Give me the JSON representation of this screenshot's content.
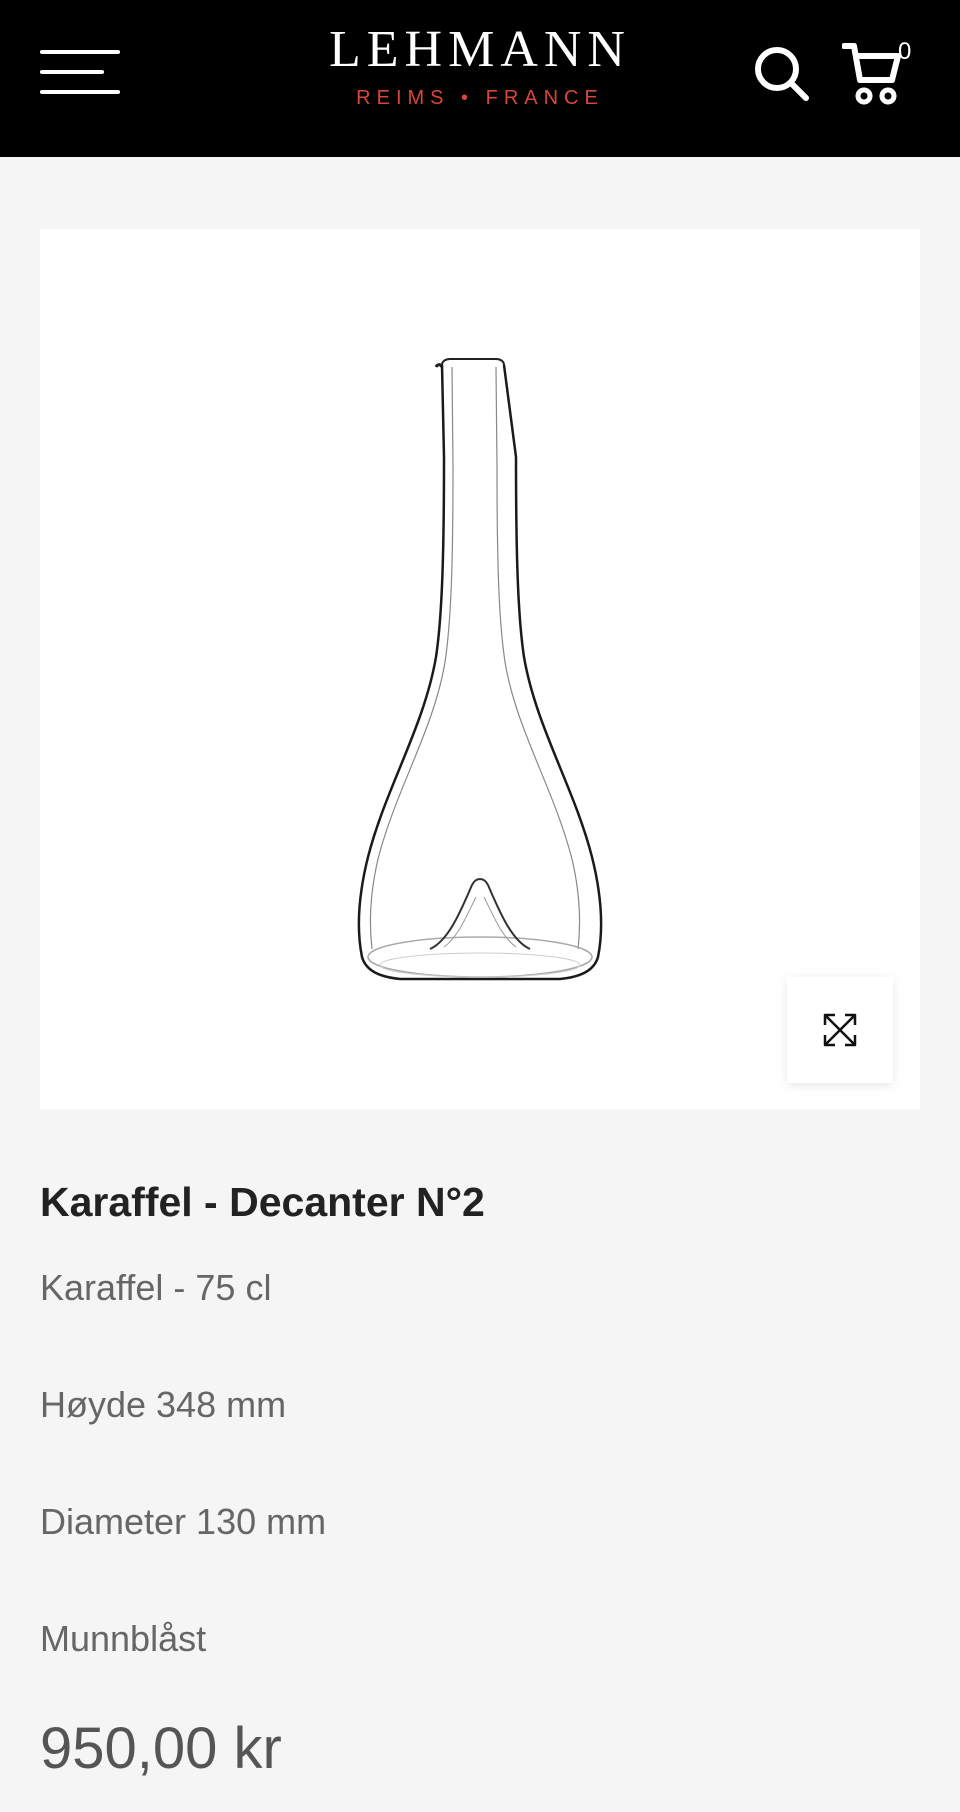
{
  "header": {
    "brand_name": "LEHMANN",
    "brand_tagline": "REIMS • FRANCE",
    "cart_count": "0",
    "menu_icon": "hamburger-menu-icon",
    "search_icon": "search-icon",
    "cart_icon": "shopping-cart-icon",
    "colors": {
      "background": "#000000",
      "brand_text": "#ffffff",
      "tagline": "#d9463a"
    }
  },
  "gallery": {
    "zoom_icon": "expand-arrows-icon"
  },
  "product": {
    "title": "Karaffel - Decanter N°2",
    "details": [
      "Karaffel - 75 cl",
      "Høyde 348 mm",
      "Diameter 130 mm",
      "Munnblåst"
    ],
    "price": "950,00 kr"
  }
}
